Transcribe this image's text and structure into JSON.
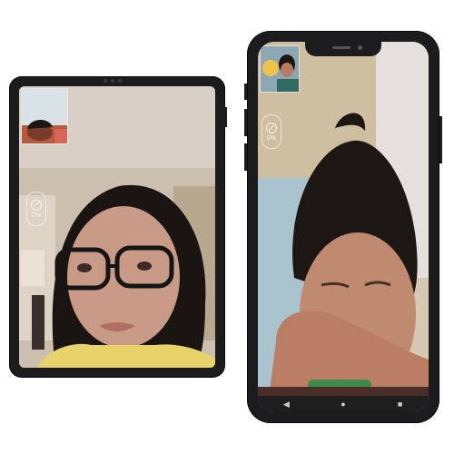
{
  "tablet": {
    "battery_percent": "0%",
    "icons": {
      "battery": "battery-saver-icon"
    }
  },
  "phone": {
    "battery_percent": "0%",
    "icons": {
      "battery": "battery-saver-icon",
      "back": "back-triangle-icon",
      "home": "home-circle-icon",
      "recents": "recents-square-icon"
    },
    "nav": {
      "back": "◀",
      "home": "●",
      "recents": "■"
    }
  },
  "colors": {
    "device_frame": "#1c1c1e",
    "nav_bar": "#1e1e1e"
  }
}
